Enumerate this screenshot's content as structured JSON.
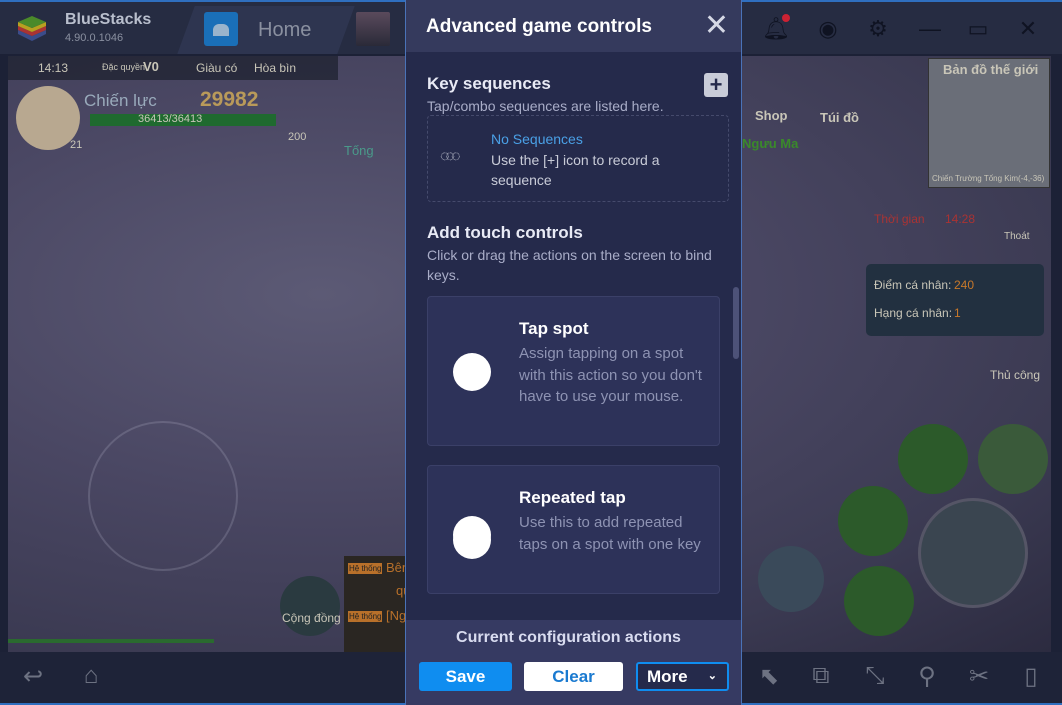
{
  "app": {
    "name": "BlueStacks",
    "version": "4.90.0.1046",
    "tab_home": "Home"
  },
  "game": {
    "time": "14:13",
    "privilege": "Đặc quyền",
    "vip": "V0",
    "rich": "Giàu có",
    "peace": "Hòa bìn",
    "power_label": "Chiến lực",
    "power_value": "29982",
    "hp": "36413/36413",
    "level": "21",
    "potion": "200",
    "tong": "Tống",
    "shop": "Shop",
    "bag": "Túi đồ",
    "npc": "Ngưu Ma",
    "map_title": "Bản đồ thế giới",
    "map_location": "Chiến Trường Tống Kim(-4,-36)",
    "time_label": "Thời gian",
    "time_value": "14:28",
    "exit": "Thoát",
    "score_label": "Điểm cá nhân:",
    "score_value": "240",
    "rank_label": "Hạng cá nhân:",
    "rank_value": "1",
    "manual": "Thủ công",
    "community": "Cộng đồng",
    "sys_tag": "Hệ thống",
    "chat1": "Bên",
    "chat1b": "quy",
    "chat2": "[Ng"
  },
  "panel": {
    "title": "Advanced game controls",
    "key_sequences": {
      "title": "Key sequences",
      "subtitle": "Tap/combo sequences are listed here.",
      "empty_title": "No Sequences",
      "empty_desc": "Use the [+] icon to record a sequence"
    },
    "touch": {
      "title": "Add touch controls",
      "subtitle": "Click or drag the actions on the screen to bind keys.",
      "cards": [
        {
          "title": "Tap spot",
          "desc": "Assign tapping on a spot with this action so you don't have to use your mouse."
        },
        {
          "title": "Repeated tap",
          "desc": "Use this to add repeated taps on a spot with one key"
        }
      ]
    },
    "footer": {
      "title": "Current configuration actions",
      "save": "Save",
      "clear": "Clear",
      "more": "More"
    }
  },
  "colors": {
    "accent": "#0f8df0",
    "panel_bg": "#252a4b",
    "card_bg": "#2d3259",
    "link": "#4aa0e6"
  }
}
